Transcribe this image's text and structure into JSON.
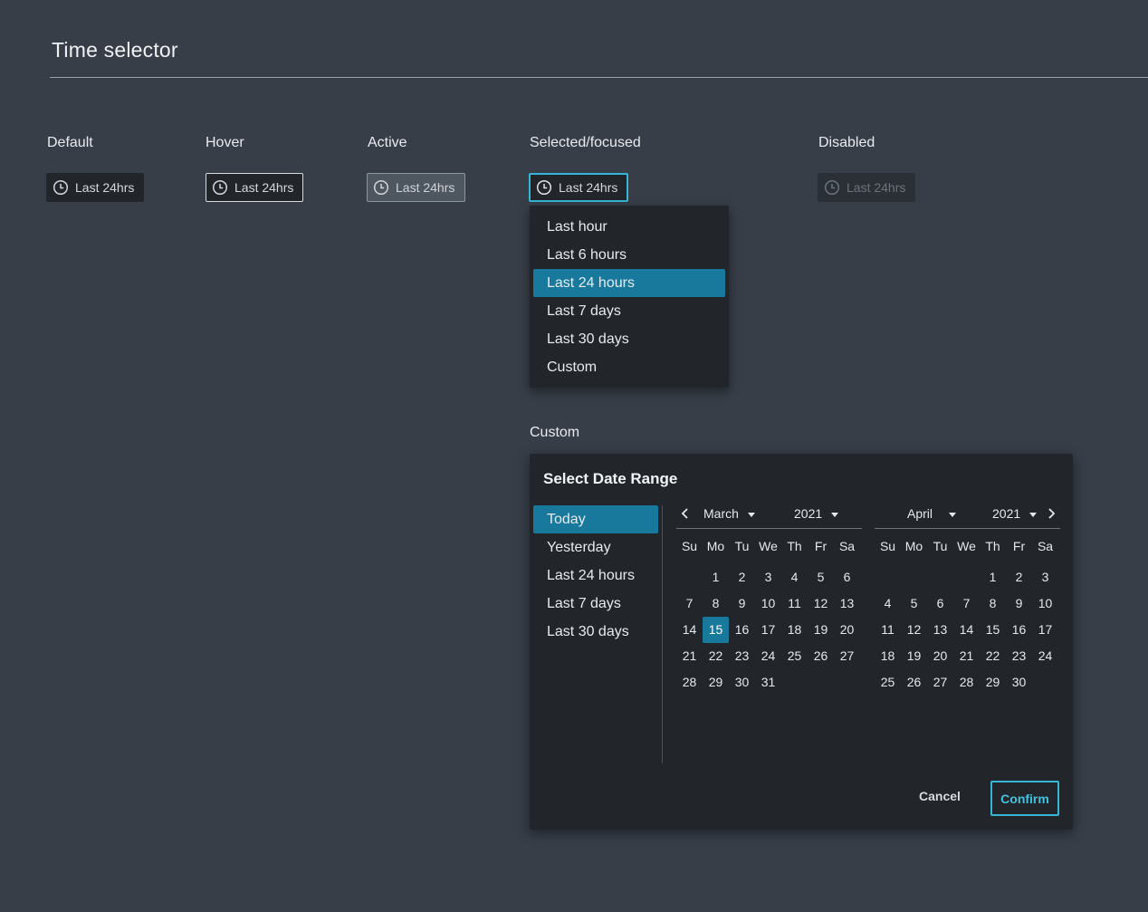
{
  "page": {
    "title": "Time selector"
  },
  "states": [
    {
      "label": "Default",
      "button_label": "Last 24hrs"
    },
    {
      "label": "Hover",
      "button_label": "Last 24hrs"
    },
    {
      "label": "Active",
      "button_label": "Last 24hrs"
    },
    {
      "label": "Selected/focused",
      "button_label": "Last 24hrs"
    },
    {
      "label": "Disabled",
      "button_label": "Last 24hrs"
    }
  ],
  "dropdown": {
    "items": [
      "Last hour",
      "Last 6 hours",
      "Last 24 hours",
      "Last 7 days",
      "Last 30 days",
      "Custom"
    ],
    "selected": "Last 24 hours"
  },
  "custom": {
    "label": "Custom",
    "title": "Select Date Range",
    "presets": [
      "Today",
      "Yesterday",
      "Last 24 hours",
      "Last 7 days",
      "Last 30 days"
    ],
    "selected_preset": "Today",
    "weekdays": [
      "Su",
      "Mo",
      "Tu",
      "We",
      "Th",
      "Fr",
      "Sa"
    ],
    "left_calendar": {
      "month": "March",
      "year": "2021",
      "weeks": [
        [
          "",
          "1",
          "2",
          "3",
          "4",
          "5",
          "6"
        ],
        [
          "7",
          "8",
          "9",
          "10",
          "11",
          "12",
          "13"
        ],
        [
          "14",
          "15",
          "16",
          "17",
          "18",
          "19",
          "20"
        ],
        [
          "21",
          "22",
          "23",
          "24",
          "25",
          "26",
          "27"
        ],
        [
          "28",
          "29",
          "30",
          "31",
          "",
          "",
          ""
        ]
      ],
      "selected_day": "15"
    },
    "right_calendar": {
      "month": "April",
      "year": "2021",
      "weeks": [
        [
          "",
          "",
          "",
          "",
          "1",
          "2",
          "3"
        ],
        [
          "4",
          "5",
          "6",
          "7",
          "8",
          "9",
          "10"
        ],
        [
          "11",
          "12",
          "13",
          "14",
          "15",
          "16",
          "17"
        ],
        [
          "18",
          "19",
          "20",
          "21",
          "22",
          "23",
          "24"
        ],
        [
          "25",
          "26",
          "27",
          "28",
          "29",
          "30",
          ""
        ]
      ]
    },
    "cancel_label": "Cancel",
    "confirm_label": "Confirm"
  },
  "colors": {
    "background": "#373e48",
    "surface": "#22262b",
    "accent_selected": "#18799d",
    "focus_border": "#35b6d6"
  },
  "icons": {
    "clock": "clock-icon",
    "prev_month": "chevron-left-icon",
    "next_month": "chevron-right-icon",
    "dropdown_caret": "caret-down-icon"
  }
}
